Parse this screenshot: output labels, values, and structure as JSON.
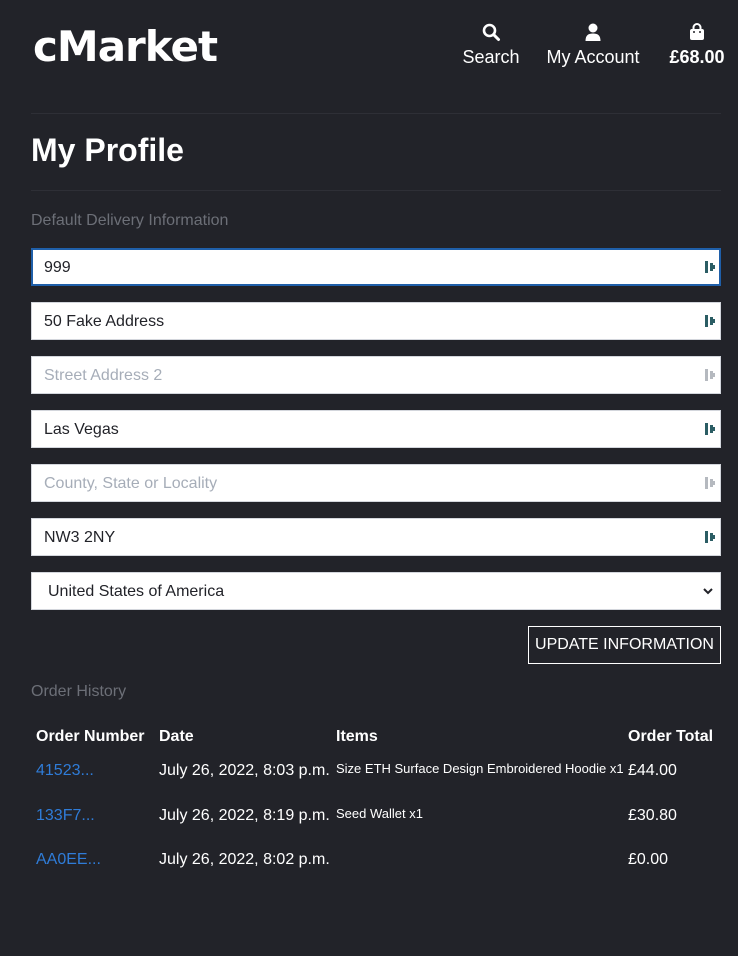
{
  "header": {
    "logo": "cMarket",
    "search_label": "Search",
    "account_label": "My Account",
    "bag_total": "£68.00"
  },
  "profile": {
    "title": "My Profile",
    "delivery_label": "Default Delivery Information",
    "fields": [
      {
        "value": "999",
        "placeholder": ""
      },
      {
        "value": "50 Fake Address",
        "placeholder": ""
      },
      {
        "value": "",
        "placeholder": "Street Address 2"
      },
      {
        "value": "Las Vegas",
        "placeholder": ""
      },
      {
        "value": "",
        "placeholder": "County, State or Locality"
      },
      {
        "value": "NW3 2NY",
        "placeholder": ""
      }
    ],
    "country": "United States of America",
    "update_button": "UPDATE INFORMATION"
  },
  "orders": {
    "label": "Order History",
    "columns": [
      "Order Number",
      "Date",
      "Items",
      "Order Total"
    ],
    "rows": [
      {
        "number": "41523...",
        "date": "July 26, 2022, 8:03 p.m.",
        "items": "Size ETH Surface Design Embroidered Hoodie x1",
        "total": "£44.00"
      },
      {
        "number": "133F7...",
        "date": "July 26, 2022, 8:19 p.m.",
        "items": "Seed Wallet x1",
        "total": "£30.80"
      },
      {
        "number": "AA0EE...",
        "date": "July 26, 2022, 8:02 p.m.",
        "items": "",
        "total": "£0.00"
      }
    ]
  },
  "colors": {
    "background": "#222329",
    "link": "#2f7cd8",
    "focus": "#1f5fa9",
    "muted": "#6c6f77"
  }
}
